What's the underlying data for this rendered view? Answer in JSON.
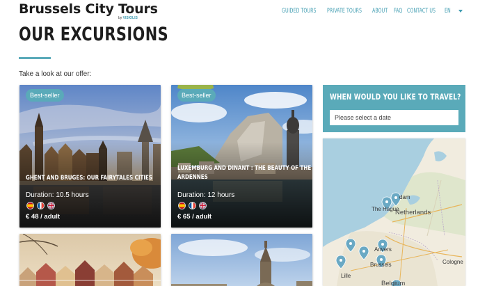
{
  "header": {
    "logo_title": "Brussels City Tours",
    "logo_sub_prefix": "by",
    "logo_sub_brand": "VISIOLIS",
    "nav": [
      "GUIDED TOURS",
      "PRIVATE TOURS",
      "ABOUT",
      "FAQ",
      "CONTACT US"
    ],
    "language": "EN"
  },
  "page": {
    "title": "OUR EXCURSIONS",
    "intro": "Take a look at our offer:"
  },
  "cards": [
    {
      "badge": "Best-seller",
      "title": "GHENT AND BRUGES: OUR FAIRYTALES CITIES",
      "duration": "Duration: 10.5 hours",
      "price": "€ 48 / adult"
    },
    {
      "badge": "Best-seller",
      "title": "LUXEMBURG AND DINANT : THE BEAUTY OF THE ARDENNES",
      "duration": "Duration: 12 hours",
      "price": "€ 65 / adult"
    }
  ],
  "booking": {
    "title": "WHEN WOULD YOU LIKE TO TRAVEL?",
    "placeholder": "Please select a date"
  },
  "map": {
    "labels": {
      "amsterdam": "dam",
      "the_hague": "The Hague",
      "netherlands": "Netherlands",
      "antwerp": "Anvers",
      "brussels": "Brussels",
      "lille": "Lille",
      "cologne": "Cologne",
      "belgium": "Belgium"
    }
  },
  "colors": {
    "accent": "#5aaab9",
    "nav": "#3d9bb0",
    "marker": "#6aa9c4"
  }
}
